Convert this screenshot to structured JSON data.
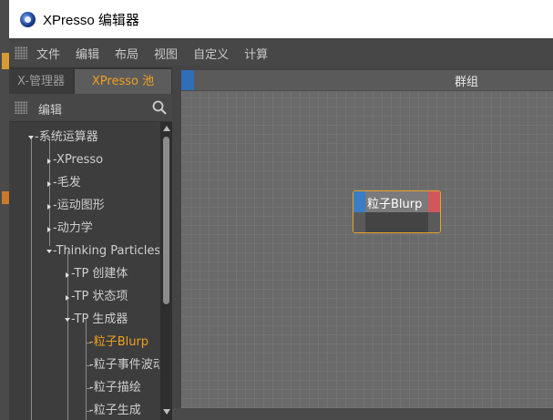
{
  "window": {
    "title": "XPresso 编辑器"
  },
  "menu": {
    "items": [
      "文件",
      "编辑",
      "布局",
      "视图",
      "自定义",
      "计算"
    ]
  },
  "left_panel": {
    "tabs": [
      {
        "label": "X-管理器",
        "active": false
      },
      {
        "label": "XPresso 池",
        "active": true
      }
    ],
    "toolbar_label": "编辑",
    "tree": [
      {
        "label": "-系统运算器",
        "level": 0,
        "expanded": true
      },
      {
        "label": "-XPresso",
        "level": 1,
        "expanded": false
      },
      {
        "label": "-毛发",
        "level": 1,
        "expanded": false
      },
      {
        "label": "-运动图形",
        "level": 1,
        "expanded": false
      },
      {
        "label": "-动力学",
        "level": 1,
        "expanded": false
      },
      {
        "label": "-Thinking Particles",
        "level": 1,
        "expanded": true
      },
      {
        "label": "-TP 创建体",
        "level": 2,
        "expanded": false
      },
      {
        "label": "-TP 状态项",
        "level": 2,
        "expanded": false
      },
      {
        "label": "-TP 生成器",
        "level": 2,
        "expanded": true
      },
      {
        "label": "-粒子Blurp",
        "level": 3,
        "selected": true
      },
      {
        "label": "-粒子事件波动",
        "level": 3
      },
      {
        "label": "-粒子描绘",
        "level": 3
      },
      {
        "label": "-粒子生成",
        "level": 3
      }
    ]
  },
  "canvas": {
    "group_title": "群组",
    "node": {
      "title": "粒子Blurp"
    }
  },
  "colors": {
    "accent": "#f0a020",
    "port_in": "#3a7dc4",
    "port_out": "#d0585a",
    "group_accent": "#2e6fb8"
  }
}
